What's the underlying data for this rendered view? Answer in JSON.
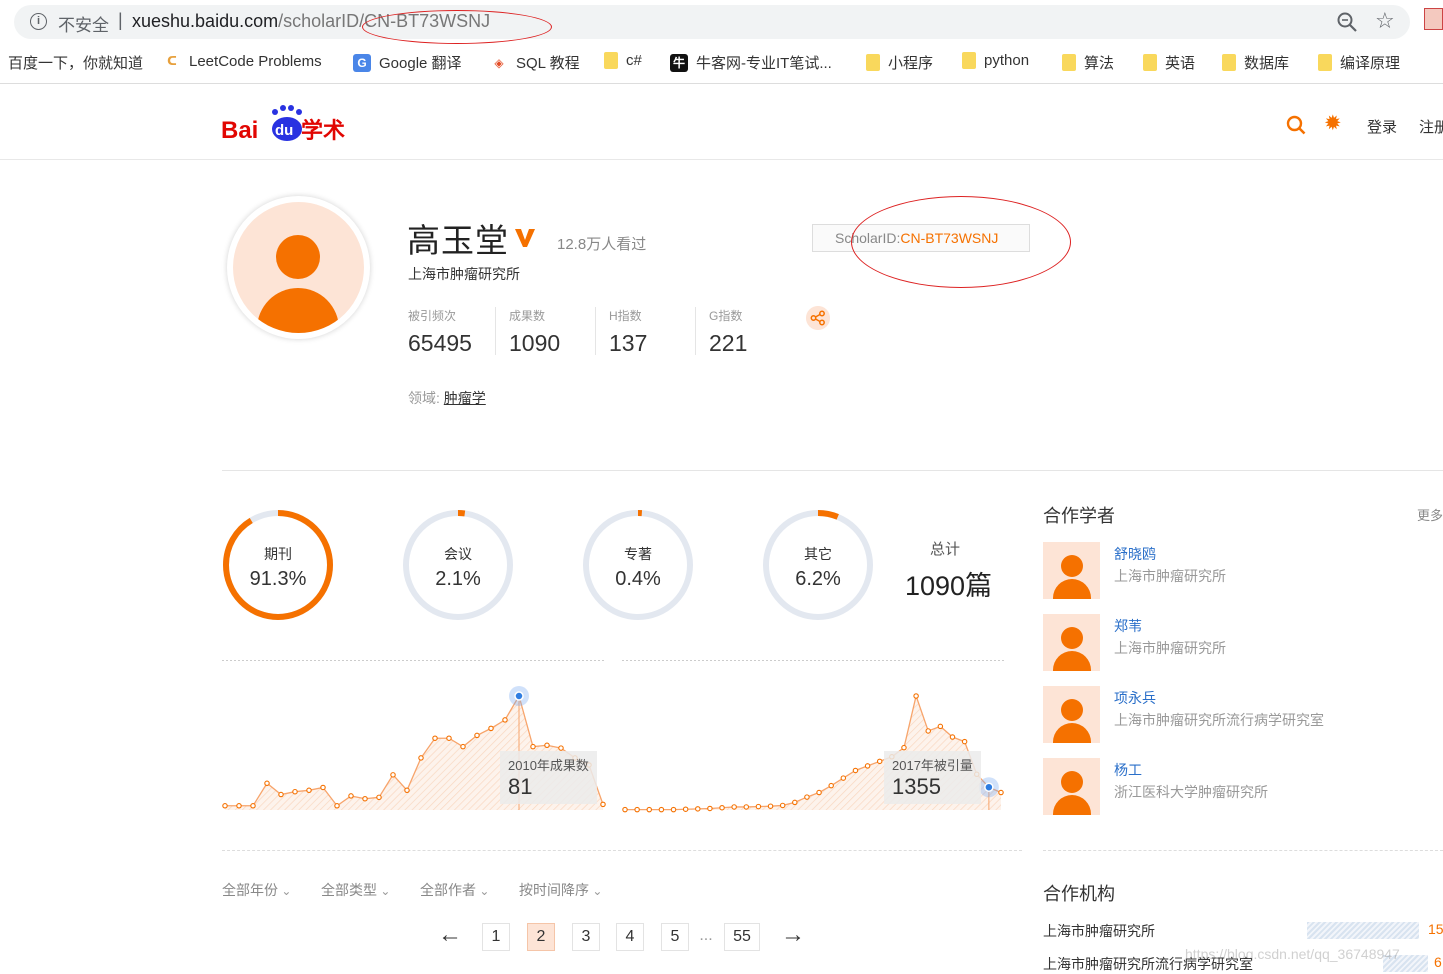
{
  "browser": {
    "insecure_label": "不安全",
    "url_separator": "|",
    "url_host": "xueshu.baidu.com",
    "url_path": "/scholarID/CN-BT73WSNJ",
    "bookmarks": [
      {
        "label": "百度一下，你就知道",
        "icon": "none"
      },
      {
        "label": "LeetCode Problems",
        "icon": "leetcode-icon"
      },
      {
        "label": "Google 翻译",
        "icon": "google-translate-icon"
      },
      {
        "label": "SQL 教程",
        "icon": "w3-icon"
      },
      {
        "label": "c#",
        "icon": "folder-icon"
      },
      {
        "label": "牛客网-专业IT笔试...",
        "icon": "nowcoder-icon"
      },
      {
        "label": "小程序",
        "icon": "folder-icon"
      },
      {
        "label": "python",
        "icon": "folder-icon"
      },
      {
        "label": "算法",
        "icon": "folder-icon"
      },
      {
        "label": "英语",
        "icon": "folder-icon"
      },
      {
        "label": "数据库",
        "icon": "folder-icon"
      },
      {
        "label": "编译原理",
        "icon": "folder-icon"
      }
    ]
  },
  "header": {
    "logo_bai": "Bai",
    "logo_du": "du",
    "logo_xueshu": "学术",
    "login": "登录",
    "register": "注册"
  },
  "profile": {
    "name": "高玉堂",
    "views": "12.8万人看过",
    "affiliation": "上海市肿瘤研究所",
    "scholar_id_label": "ScholarID:",
    "scholar_id_value": "CN-BT73WSNJ",
    "metrics": [
      {
        "label": "被引频次",
        "value": "65495"
      },
      {
        "label": "成果数",
        "value": "1090"
      },
      {
        "label": "H指数",
        "value": "137"
      },
      {
        "label": "G指数",
        "value": "221"
      }
    ],
    "field_label": "领域:",
    "field_value": "肿瘤学"
  },
  "breakdown": {
    "items": [
      {
        "label": "期刊",
        "value": "91.3%",
        "fraction": 0.913
      },
      {
        "label": "会议",
        "value": "2.1%",
        "fraction": 0.021
      },
      {
        "label": "专著",
        "value": "0.4%",
        "fraction": 0.004
      },
      {
        "label": "其它",
        "value": "6.2%",
        "fraction": 0.062
      }
    ],
    "total_label": "总计",
    "total_value": "1090篇",
    "accent": "#f57100",
    "track": "#e3e8f0"
  },
  "chart_data": [
    {
      "type": "area",
      "series": [
        {
          "values": [
            3,
            3,
            3,
            19,
            11,
            13,
            14,
            16,
            3,
            10,
            8,
            9,
            25,
            14,
            37,
            51,
            51,
            45,
            53,
            58,
            64,
            81,
            45,
            46,
            44,
            37,
            32,
            4
          ]
        }
      ],
      "highlight_index": 21,
      "tooltip_label": "2010年成果数",
      "tooltip_value": "81"
    },
    {
      "type": "area",
      "series": [
        {
          "values": [
            5,
            5,
            5,
            5,
            5,
            10,
            15,
            20,
            30,
            40,
            40,
            45,
            50,
            60,
            100,
            170,
            230,
            320,
            420,
            520,
            580,
            640,
            700,
            820,
            1500,
            1040,
            1100,
            960,
            900,
            470,
            300,
            230
          ]
        }
      ],
      "highlight_index": 30,
      "tooltip_label": "2017年被引量",
      "tooltip_value": "1355"
    }
  ],
  "filters": [
    "全部年份",
    "全部类型",
    "全部作者",
    "按时间降序"
  ],
  "pagination": {
    "prev": "←",
    "pages": [
      "1",
      "2",
      "3",
      "4",
      "5"
    ],
    "ellipsis": "...",
    "last": "55",
    "next": "→",
    "active": "2"
  },
  "coauthors": {
    "title": "合作学者",
    "more": "更多",
    "items": [
      {
        "name": "舒晓鸥",
        "affiliation": "上海市肿瘤研究所"
      },
      {
        "name": "郑苇",
        "affiliation": "上海市肿瘤研究所"
      },
      {
        "name": "项永兵",
        "affiliation": "上海市肿瘤研究所流行病学研究室"
      },
      {
        "name": "杨工",
        "affiliation": "浙江医科大学肿瘤研究所"
      }
    ]
  },
  "institutions": {
    "title": "合作机构",
    "items": [
      {
        "name": "上海市肿瘤研究所",
        "count": "15"
      },
      {
        "name": "上海市肿瘤研究所流行病学研究室",
        "count": "6"
      }
    ]
  },
  "watermark": "https://blog.csdn.net/qq_36748947"
}
